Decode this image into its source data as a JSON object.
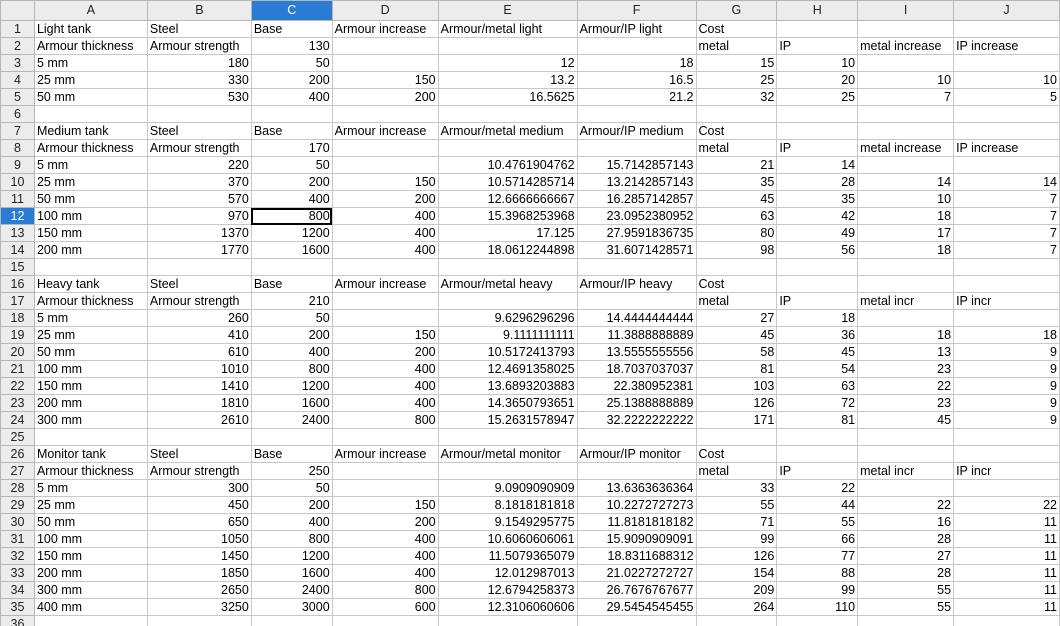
{
  "columns": [
    "",
    "A",
    "B",
    "C",
    "D",
    "E",
    "F",
    "G",
    "H",
    "I",
    "J"
  ],
  "active_cell": {
    "row": 12,
    "col": "C"
  },
  "rows": [
    {
      "n": "1",
      "cells": [
        "Light tank",
        "Steel",
        "Base",
        "Armour increase",
        "Armour/metal light",
        "Armour/IP light",
        "Cost",
        "",
        "",
        ""
      ]
    },
    {
      "n": "2",
      "cells": [
        "Armour thickness",
        "Armour strength",
        "130",
        "",
        "",
        "",
        "metal",
        "IP",
        "metal increase",
        "IP increase"
      ]
    },
    {
      "n": "3",
      "cells": [
        "5 mm",
        "180",
        "50",
        "",
        "12",
        "18",
        "15",
        "10",
        "",
        ""
      ]
    },
    {
      "n": "4",
      "cells": [
        "25 mm",
        "330",
        "200",
        "150",
        "13.2",
        "16.5",
        "25",
        "20",
        "10",
        "10"
      ]
    },
    {
      "n": "5",
      "cells": [
        "50 mm",
        "530",
        "400",
        "200",
        "16.5625",
        "21.2",
        "32",
        "25",
        "7",
        "5"
      ]
    },
    {
      "n": "6",
      "cells": [
        "",
        "",
        "",
        "",
        "",
        "",
        "",
        "",
        "",
        ""
      ]
    },
    {
      "n": "7",
      "cells": [
        "Medium tank",
        "Steel",
        "Base",
        "Armour increase",
        "Armour/metal medium",
        "Armour/IP medium",
        "Cost",
        "",
        "",
        ""
      ]
    },
    {
      "n": "8",
      "cells": [
        "Armour thickness",
        "Armour strength",
        "170",
        "",
        "",
        "",
        "metal",
        "IP",
        "metal increase",
        "IP increase"
      ]
    },
    {
      "n": "9",
      "cells": [
        "5 mm",
        "220",
        "50",
        "",
        "10.4761904762",
        "15.7142857143",
        "21",
        "14",
        "",
        ""
      ]
    },
    {
      "n": "10",
      "cells": [
        "25 mm",
        "370",
        "200",
        "150",
        "10.5714285714",
        "13.2142857143",
        "35",
        "28",
        "14",
        "14"
      ]
    },
    {
      "n": "11",
      "cells": [
        "50 mm",
        "570",
        "400",
        "200",
        "12.6666666667",
        "16.2857142857",
        "45",
        "35",
        "10",
        "7"
      ]
    },
    {
      "n": "12",
      "cells": [
        "100 mm",
        "970",
        "800",
        "400",
        "15.3968253968",
        "23.0952380952",
        "63",
        "42",
        "18",
        "7"
      ]
    },
    {
      "n": "13",
      "cells": [
        "150 mm",
        "1370",
        "1200",
        "400",
        "17.125",
        "27.9591836735",
        "80",
        "49",
        "17",
        "7"
      ]
    },
    {
      "n": "14",
      "cells": [
        "200 mm",
        "1770",
        "1600",
        "400",
        "18.0612244898",
        "31.6071428571",
        "98",
        "56",
        "18",
        "7"
      ]
    },
    {
      "n": "15",
      "cells": [
        "",
        "",
        "",
        "",
        "",
        "",
        "",
        "",
        "",
        ""
      ]
    },
    {
      "n": "16",
      "cells": [
        "Heavy tank",
        "Steel",
        "Base",
        "Armour increase",
        "Armour/metal heavy",
        "Armour/IP heavy",
        "Cost",
        "",
        "",
        ""
      ]
    },
    {
      "n": "17",
      "cells": [
        "Armour thickness",
        "Armour strength",
        "210",
        "",
        "",
        "",
        "metal",
        "IP",
        "metal incr",
        "IP incr"
      ]
    },
    {
      "n": "18",
      "cells": [
        "5 mm",
        "260",
        "50",
        "",
        "9.6296296296",
        "14.4444444444",
        "27",
        "18",
        "",
        ""
      ]
    },
    {
      "n": "19",
      "cells": [
        "25 mm",
        "410",
        "200",
        "150",
        "9.1111111111",
        "11.3888888889",
        "45",
        "36",
        "18",
        "18"
      ]
    },
    {
      "n": "20",
      "cells": [
        "50 mm",
        "610",
        "400",
        "200",
        "10.5172413793",
        "13.5555555556",
        "58",
        "45",
        "13",
        "9"
      ]
    },
    {
      "n": "21",
      "cells": [
        "100 mm",
        "1010",
        "800",
        "400",
        "12.4691358025",
        "18.7037037037",
        "81",
        "54",
        "23",
        "9"
      ]
    },
    {
      "n": "22",
      "cells": [
        "150 mm",
        "1410",
        "1200",
        "400",
        "13.6893203883",
        "22.380952381",
        "103",
        "63",
        "22",
        "9"
      ]
    },
    {
      "n": "23",
      "cells": [
        "200 mm",
        "1810",
        "1600",
        "400",
        "14.3650793651",
        "25.1388888889",
        "126",
        "72",
        "23",
        "9"
      ]
    },
    {
      "n": "24",
      "cells": [
        "300 mm",
        "2610",
        "2400",
        "800",
        "15.2631578947",
        "32.2222222222",
        "171",
        "81",
        "45",
        "9"
      ]
    },
    {
      "n": "25",
      "cells": [
        "",
        "",
        "",
        "",
        "",
        "",
        "",
        "",
        "",
        ""
      ]
    },
    {
      "n": "26",
      "cells": [
        "Monitor tank",
        "Steel",
        "Base",
        "Armour increase",
        "Armour/metal monitor",
        "Armour/IP monitor",
        "Cost",
        "",
        "",
        ""
      ]
    },
    {
      "n": "27",
      "cells": [
        "Armour thickness",
        "Armour strength",
        "250",
        "",
        "",
        "",
        "metal",
        "IP",
        "metal incr",
        "IP incr"
      ]
    },
    {
      "n": "28",
      "cells": [
        "5 mm",
        "300",
        "50",
        "",
        "9.0909090909",
        "13.6363636364",
        "33",
        "22",
        "",
        ""
      ]
    },
    {
      "n": "29",
      "cells": [
        "25 mm",
        "450",
        "200",
        "150",
        "8.1818181818",
        "10.2272727273",
        "55",
        "44",
        "22",
        "22"
      ]
    },
    {
      "n": "30",
      "cells": [
        "50 mm",
        "650",
        "400",
        "200",
        "9.1549295775",
        "11.8181818182",
        "71",
        "55",
        "16",
        "11"
      ]
    },
    {
      "n": "31",
      "cells": [
        "100 mm",
        "1050",
        "800",
        "400",
        "10.6060606061",
        "15.9090909091",
        "99",
        "66",
        "28",
        "11"
      ]
    },
    {
      "n": "32",
      "cells": [
        "150 mm",
        "1450",
        "1200",
        "400",
        "11.5079365079",
        "18.8311688312",
        "126",
        "77",
        "27",
        "11"
      ]
    },
    {
      "n": "33",
      "cells": [
        "200 mm",
        "1850",
        "1600",
        "400",
        "12.012987013",
        "21.0227272727",
        "154",
        "88",
        "28",
        "11"
      ]
    },
    {
      "n": "34",
      "cells": [
        "300 mm",
        "2650",
        "2400",
        "800",
        "12.6794258373",
        "26.7676767677",
        "209",
        "99",
        "55",
        "11"
      ]
    },
    {
      "n": "35",
      "cells": [
        "400 mm",
        "3250",
        "3000",
        "600",
        "12.3106060606",
        "29.5454545455",
        "264",
        "110",
        "55",
        "11"
      ]
    },
    {
      "n": "36",
      "cells": [
        "",
        "",
        "",
        "",
        "",
        "",
        "",
        "",
        "",
        ""
      ]
    }
  ]
}
